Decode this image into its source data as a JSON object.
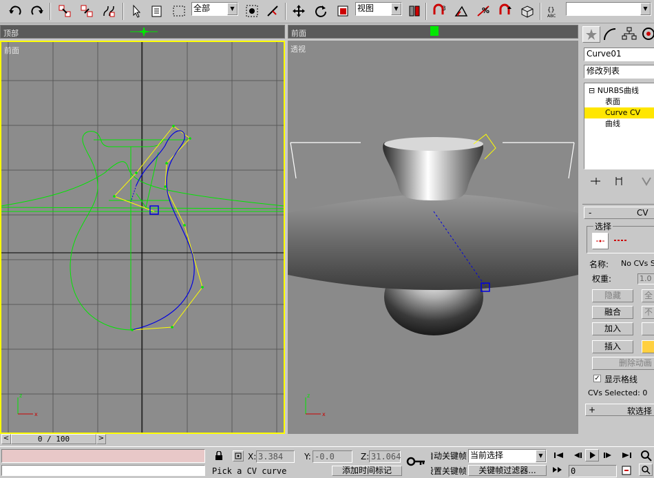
{
  "toolbar": {
    "selection_filter": "全部",
    "ref_coord": "视图",
    "snap_angle": "3",
    "snap_percent": "%",
    "named_sel": "",
    "icons": [
      "undo-icon",
      "redo-icon",
      "link-icon",
      "unlink-icon",
      "bind-spacewarp-icon",
      "select-icon",
      "select-by-name-icon",
      "rect-region-icon",
      "select-center-icon",
      "select-move-icon",
      "select-rotate-icon",
      "select-scale-icon",
      "mirror-icon",
      "align-icon",
      "snap-icon",
      "angle-snap-icon",
      "percent-snap-icon",
      "spinner-snap-icon",
      "material-editor-icon",
      "edit-named-sel-icon"
    ]
  },
  "viewports": {
    "top": {
      "label": "顶部"
    },
    "front_strip": {
      "label": "前面"
    },
    "front": {
      "label": "前面"
    },
    "perspective": {
      "label": "透视"
    }
  },
  "time_slider": {
    "value": "0 / 100",
    "prev": "<",
    "next": ">"
  },
  "command_panel": {
    "object_name": "Curve01",
    "modifier_list": "修改列表",
    "stack": [
      {
        "label": "NURBS曲线",
        "prefix": "⊟",
        "selected": false,
        "indent": 0
      },
      {
        "label": "表面",
        "selected": false,
        "indent": 1
      },
      {
        "label": "Curve CV",
        "selected": true,
        "indent": 1
      },
      {
        "label": "曲线",
        "selected": false,
        "indent": 1
      }
    ],
    "rollout_title": "CV",
    "rollout_minus": "-",
    "selection_group": "选择",
    "name_label": "名称:",
    "name_value": "No CVs Se",
    "weight_label": "权重:",
    "weight_value": "1.0",
    "buttons": {
      "hide": "隐藏",
      "unhide_all": "全",
      "fuse": "融合",
      "unfuse": "不",
      "add": "加入",
      "insert": "插入",
      "delete_anim": "删除动画"
    },
    "show_lattice": "显示格线",
    "show_lattice_checked": true,
    "cvs_selected": "CVs Selected: 0",
    "soft_select": "软选择",
    "soft_select_plus": "+"
  },
  "status": {
    "x_label": "X:",
    "x_value": "3.384",
    "y_label": "Y:",
    "y_value": "-0.0",
    "z_label": "Z:",
    "z_value": "31.064",
    "prompt": "Pick a CV curve",
    "add_time_tag": "添加时间标记",
    "auto_key": "自动关键帧",
    "set_key": "设置关键帧",
    "key_mode": "当前选择",
    "key_filters": "关键帧过滤器...",
    "frame": "0"
  },
  "colors": {
    "active_border": "#ffff00",
    "curve_green": "#00e600",
    "cv_yellow": "#ffff00",
    "curve_blue": "#0000e0",
    "stack_selected": "#ffe600"
  }
}
